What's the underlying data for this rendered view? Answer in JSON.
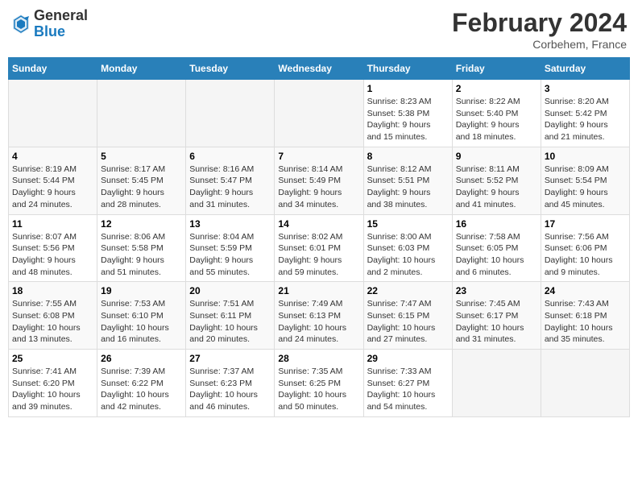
{
  "header": {
    "logo_general": "General",
    "logo_blue": "Blue",
    "title": "February 2024",
    "location": "Corbehem, France"
  },
  "days_of_week": [
    "Sunday",
    "Monday",
    "Tuesday",
    "Wednesday",
    "Thursday",
    "Friday",
    "Saturday"
  ],
  "weeks": [
    [
      {
        "day": "",
        "info": ""
      },
      {
        "day": "",
        "info": ""
      },
      {
        "day": "",
        "info": ""
      },
      {
        "day": "",
        "info": ""
      },
      {
        "day": "1",
        "info": "Sunrise: 8:23 AM\nSunset: 5:38 PM\nDaylight: 9 hours\nand 15 minutes."
      },
      {
        "day": "2",
        "info": "Sunrise: 8:22 AM\nSunset: 5:40 PM\nDaylight: 9 hours\nand 18 minutes."
      },
      {
        "day": "3",
        "info": "Sunrise: 8:20 AM\nSunset: 5:42 PM\nDaylight: 9 hours\nand 21 minutes."
      }
    ],
    [
      {
        "day": "4",
        "info": "Sunrise: 8:19 AM\nSunset: 5:44 PM\nDaylight: 9 hours\nand 24 minutes."
      },
      {
        "day": "5",
        "info": "Sunrise: 8:17 AM\nSunset: 5:45 PM\nDaylight: 9 hours\nand 28 minutes."
      },
      {
        "day": "6",
        "info": "Sunrise: 8:16 AM\nSunset: 5:47 PM\nDaylight: 9 hours\nand 31 minutes."
      },
      {
        "day": "7",
        "info": "Sunrise: 8:14 AM\nSunset: 5:49 PM\nDaylight: 9 hours\nand 34 minutes."
      },
      {
        "day": "8",
        "info": "Sunrise: 8:12 AM\nSunset: 5:51 PM\nDaylight: 9 hours\nand 38 minutes."
      },
      {
        "day": "9",
        "info": "Sunrise: 8:11 AM\nSunset: 5:52 PM\nDaylight: 9 hours\nand 41 minutes."
      },
      {
        "day": "10",
        "info": "Sunrise: 8:09 AM\nSunset: 5:54 PM\nDaylight: 9 hours\nand 45 minutes."
      }
    ],
    [
      {
        "day": "11",
        "info": "Sunrise: 8:07 AM\nSunset: 5:56 PM\nDaylight: 9 hours\nand 48 minutes."
      },
      {
        "day": "12",
        "info": "Sunrise: 8:06 AM\nSunset: 5:58 PM\nDaylight: 9 hours\nand 51 minutes."
      },
      {
        "day": "13",
        "info": "Sunrise: 8:04 AM\nSunset: 5:59 PM\nDaylight: 9 hours\nand 55 minutes."
      },
      {
        "day": "14",
        "info": "Sunrise: 8:02 AM\nSunset: 6:01 PM\nDaylight: 9 hours\nand 59 minutes."
      },
      {
        "day": "15",
        "info": "Sunrise: 8:00 AM\nSunset: 6:03 PM\nDaylight: 10 hours\nand 2 minutes."
      },
      {
        "day": "16",
        "info": "Sunrise: 7:58 AM\nSunset: 6:05 PM\nDaylight: 10 hours\nand 6 minutes."
      },
      {
        "day": "17",
        "info": "Sunrise: 7:56 AM\nSunset: 6:06 PM\nDaylight: 10 hours\nand 9 minutes."
      }
    ],
    [
      {
        "day": "18",
        "info": "Sunrise: 7:55 AM\nSunset: 6:08 PM\nDaylight: 10 hours\nand 13 minutes."
      },
      {
        "day": "19",
        "info": "Sunrise: 7:53 AM\nSunset: 6:10 PM\nDaylight: 10 hours\nand 16 minutes."
      },
      {
        "day": "20",
        "info": "Sunrise: 7:51 AM\nSunset: 6:11 PM\nDaylight: 10 hours\nand 20 minutes."
      },
      {
        "day": "21",
        "info": "Sunrise: 7:49 AM\nSunset: 6:13 PM\nDaylight: 10 hours\nand 24 minutes."
      },
      {
        "day": "22",
        "info": "Sunrise: 7:47 AM\nSunset: 6:15 PM\nDaylight: 10 hours\nand 27 minutes."
      },
      {
        "day": "23",
        "info": "Sunrise: 7:45 AM\nSunset: 6:17 PM\nDaylight: 10 hours\nand 31 minutes."
      },
      {
        "day": "24",
        "info": "Sunrise: 7:43 AM\nSunset: 6:18 PM\nDaylight: 10 hours\nand 35 minutes."
      }
    ],
    [
      {
        "day": "25",
        "info": "Sunrise: 7:41 AM\nSunset: 6:20 PM\nDaylight: 10 hours\nand 39 minutes."
      },
      {
        "day": "26",
        "info": "Sunrise: 7:39 AM\nSunset: 6:22 PM\nDaylight: 10 hours\nand 42 minutes."
      },
      {
        "day": "27",
        "info": "Sunrise: 7:37 AM\nSunset: 6:23 PM\nDaylight: 10 hours\nand 46 minutes."
      },
      {
        "day": "28",
        "info": "Sunrise: 7:35 AM\nSunset: 6:25 PM\nDaylight: 10 hours\nand 50 minutes."
      },
      {
        "day": "29",
        "info": "Sunrise: 7:33 AM\nSunset: 6:27 PM\nDaylight: 10 hours\nand 54 minutes."
      },
      {
        "day": "",
        "info": ""
      },
      {
        "day": "",
        "info": ""
      }
    ]
  ]
}
